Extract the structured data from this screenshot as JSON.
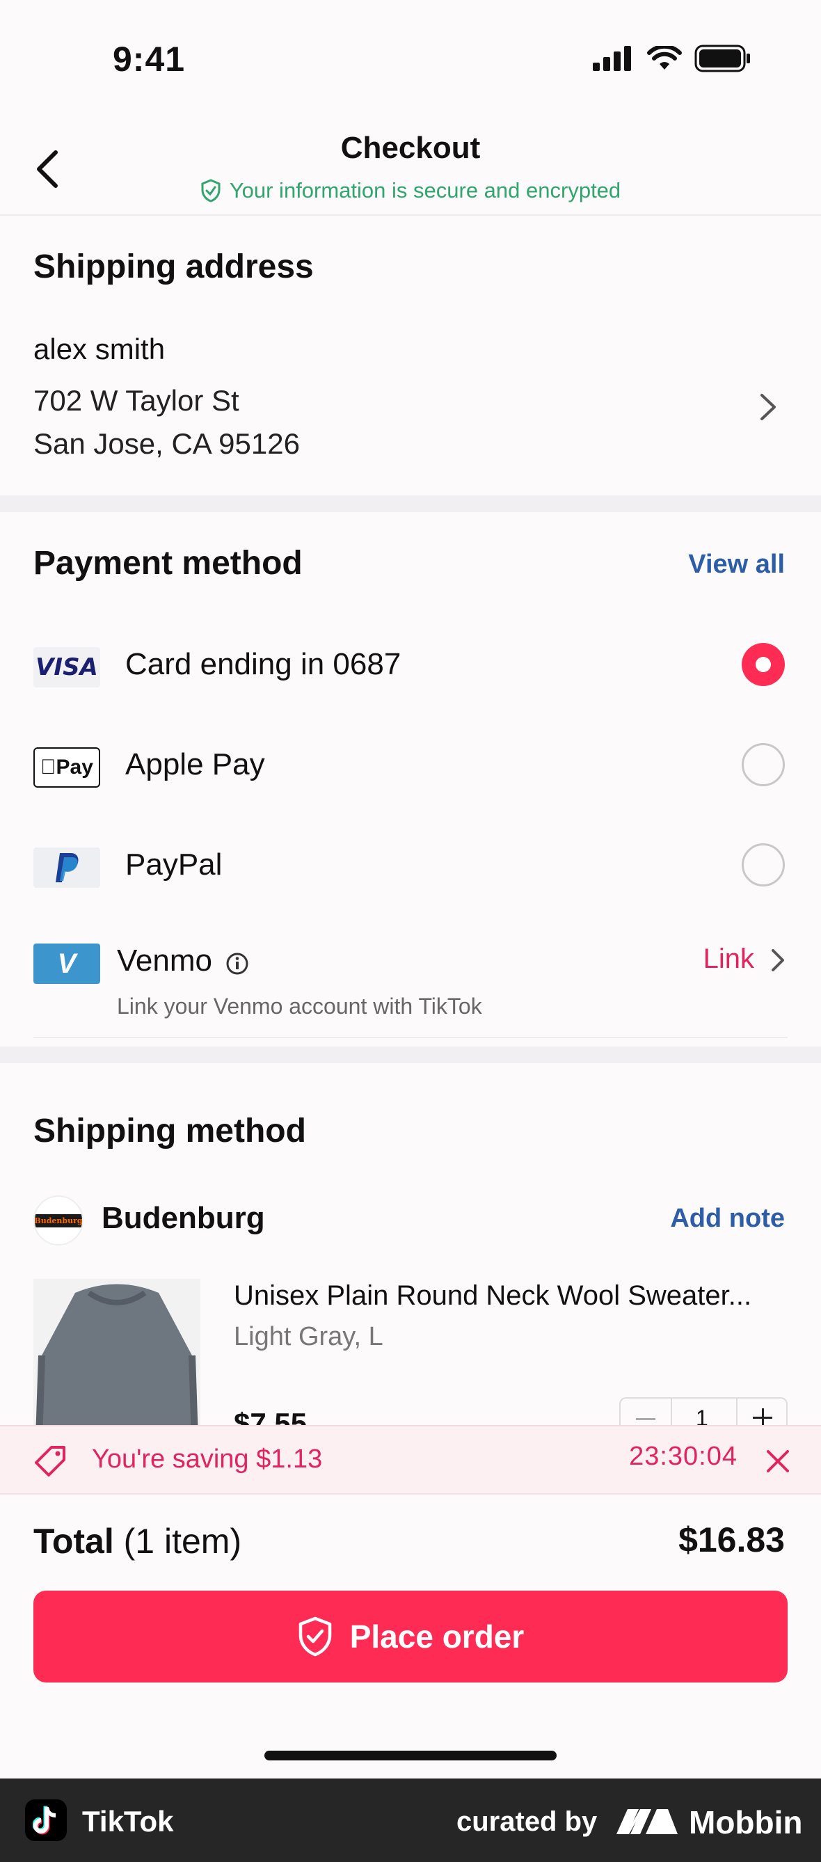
{
  "status_bar": {
    "time": "9:41"
  },
  "nav": {
    "title": "Checkout",
    "subtitle": "Your information is secure and encrypted"
  },
  "shipping_address": {
    "title": "Shipping address",
    "name": "alex smith",
    "line1": "702 W Taylor St",
    "line2": "San Jose, CA 95126"
  },
  "payment": {
    "title": "Payment method",
    "view_all": "View all",
    "options": [
      {
        "label": "Card ending in 0687",
        "logo": "VISA",
        "selected": true
      },
      {
        "label": "Apple Pay",
        "logo": "Pay",
        "selected": false
      },
      {
        "label": "PayPal",
        "logo": "paypal-icon",
        "selected": false
      }
    ],
    "venmo": {
      "label": "Venmo",
      "logo": "V",
      "subtitle": "Link your Venmo account with TikTok",
      "action": "Link"
    }
  },
  "shipping_method": {
    "title": "Shipping method",
    "shop": "Budenburg",
    "shop_logo_text": "Budenburg",
    "add_note": "Add note",
    "product": {
      "title": "Unisex Plain Round Neck Wool Sweater...",
      "variant": "Light Gray, L",
      "price": "$7.55",
      "quantity": "1"
    }
  },
  "savings": {
    "text": "You're saving $1.13",
    "timer": "23:30:04"
  },
  "total": {
    "label": "Total",
    "count": "(1 item)",
    "amount": "$16.83"
  },
  "place_order": "Place order",
  "footer": {
    "app": "TikTok",
    "curated": "curated by",
    "brand": "Mobbin"
  },
  "colors": {
    "accent": "#fe2c55",
    "secure_green": "#31a56e",
    "link_blue": "#2e5da8"
  }
}
